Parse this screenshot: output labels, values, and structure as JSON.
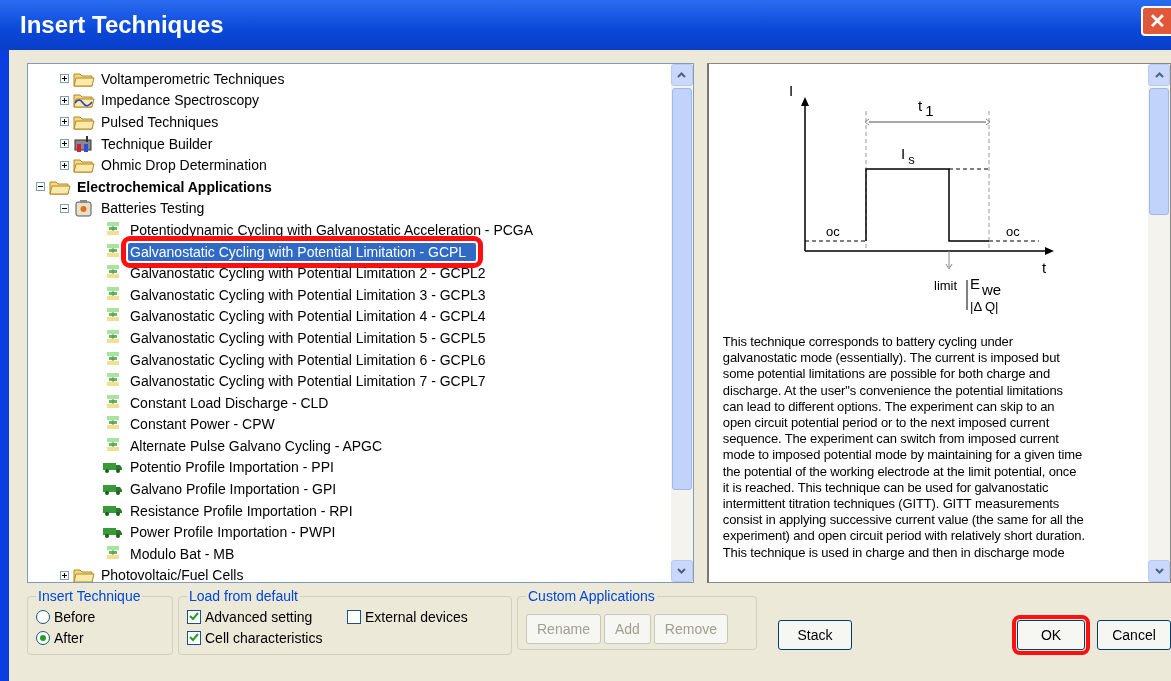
{
  "window": {
    "title": "Insert Techniques",
    "close_icon": "✕"
  },
  "tree": [
    {
      "children": [
        {
          "label": "Voltamperometric Techniques",
          "kind": "folder",
          "expanded": false,
          "selected": false
        },
        {
          "label": "Impedance Spectroscopy",
          "kind": "impedance",
          "expanded": false,
          "selected": false
        },
        {
          "label": "Pulsed Techniques",
          "kind": "folder",
          "expanded": false,
          "selected": false
        },
        {
          "label": "Technique Builder",
          "kind": "builder",
          "expanded": false,
          "selected": false
        },
        {
          "label": "Ohmic Drop Determination",
          "kind": "folder",
          "expanded": false,
          "selected": false
        }
      ]
    },
    {
      "label": "Electrochemical Applications",
      "kind": "folder",
      "bold": true,
      "expanded": true,
      "selected": false,
      "children": [
        {
          "label": "Batteries Testing",
          "kind": "battery",
          "expanded": true,
          "selected": false,
          "children": [
            {
              "label": "Potentiodynamic Cycling with Galvanostatic Acceleration - PCGA",
              "kind": "technique",
              "selected": false
            },
            {
              "label": "Galvanostatic Cycling with Potential Limitation - GCPL",
              "kind": "technique",
              "selected": true,
              "highlighted": true
            },
            {
              "label": "Galvanostatic Cycling with Potential Limitation 2 - GCPL2",
              "kind": "technique",
              "selected": false
            },
            {
              "label": "Galvanostatic Cycling with Potential Limitation 3 - GCPL3",
              "kind": "technique",
              "selected": false
            },
            {
              "label": "Galvanostatic Cycling with Potential Limitation 4 - GCPL4",
              "kind": "technique",
              "selected": false
            },
            {
              "label": "Galvanostatic Cycling with Potential Limitation 5 - GCPL5",
              "kind": "technique",
              "selected": false
            },
            {
              "label": "Galvanostatic Cycling with Potential Limitation 6 - GCPL6",
              "kind": "technique",
              "selected": false
            },
            {
              "label": "Galvanostatic Cycling with Potential Limitation 7 - GCPL7",
              "kind": "technique",
              "selected": false
            },
            {
              "label": "Constant Load Discharge - CLD",
              "kind": "technique",
              "selected": false
            },
            {
              "label": "Constant Power - CPW",
              "kind": "technique",
              "selected": false
            },
            {
              "label": "Alternate Pulse Galvano Cycling - APGC",
              "kind": "technique",
              "selected": false
            },
            {
              "label": "Potentio Profile Importation - PPI",
              "kind": "profile",
              "selected": false
            },
            {
              "label": "Galvano Profile Importation - GPI",
              "kind": "profile",
              "selected": false
            },
            {
              "label": "Resistance Profile Importation - RPI",
              "kind": "profile",
              "selected": false
            },
            {
              "label": "Power Profile Importation - PWPI",
              "kind": "profile",
              "selected": false
            },
            {
              "label": "Modulo Bat - MB",
              "kind": "technique",
              "selected": false
            }
          ]
        },
        {
          "label": "Photovoltaic/Fuel Cells",
          "kind": "folder",
          "expanded": false,
          "selected": false
        }
      ]
    }
  ],
  "diagram": {
    "y_axis": "I",
    "period": "t",
    "period_index": "1",
    "current": "I",
    "current_index": "s",
    "oc_left": "oc",
    "oc_right": "oc",
    "x_axis": "t",
    "limit": "limit",
    "limit_main": "E",
    "limit_index": "we",
    "limit_alt": "|Δ Q|"
  },
  "description_lines": [
    "This technique corresponds to battery cycling under",
    "galvanostatic mode (essentially). The current is imposed but",
    "some potential limitations are possible for both charge and",
    "discharge. At the user\"s convenience the potential limitations",
    "can lead to different options. The experiment can skip to an",
    "open circuit potential period or to the next imposed current",
    "sequence. The experiment can switch from imposed current",
    "mode to imposed potential mode by maintaining for a given time",
    "the potential of the working electrode at the limit potential, once",
    "it is reached. This technique can be used for galvanostatic",
    "intermittent titration techniques (GITT). GITT measurements",
    "consist in applying successive current value (the same for all the",
    "experiment) and open circuit period with relatively short duration.",
    "This technique is used in charge and then in discharge mode"
  ],
  "insert_technique": {
    "title": "Insert Technique",
    "options": [
      {
        "label": "Before",
        "selected": false
      },
      {
        "label": "After",
        "selected": true
      }
    ]
  },
  "load_from_default": {
    "title": "Load from default",
    "options": [
      {
        "label": "Advanced setting",
        "checked": true
      },
      {
        "label": "External devices",
        "checked": false
      },
      {
        "label": "Cell characteristics",
        "checked": true
      }
    ]
  },
  "custom_applications": {
    "title": "Custom Applications",
    "buttons": [
      {
        "label": "Rename",
        "disabled": true
      },
      {
        "label": "Add",
        "disabled": true
      },
      {
        "label": "Remove",
        "disabled": true
      }
    ]
  },
  "buttons": [
    {
      "label": "Stack",
      "kind": "stack",
      "highlighted": false
    },
    {
      "label": "OK",
      "kind": "ok",
      "highlighted": true
    },
    {
      "label": "Cancel",
      "kind": "cancel",
      "highlighted": false
    }
  ]
}
